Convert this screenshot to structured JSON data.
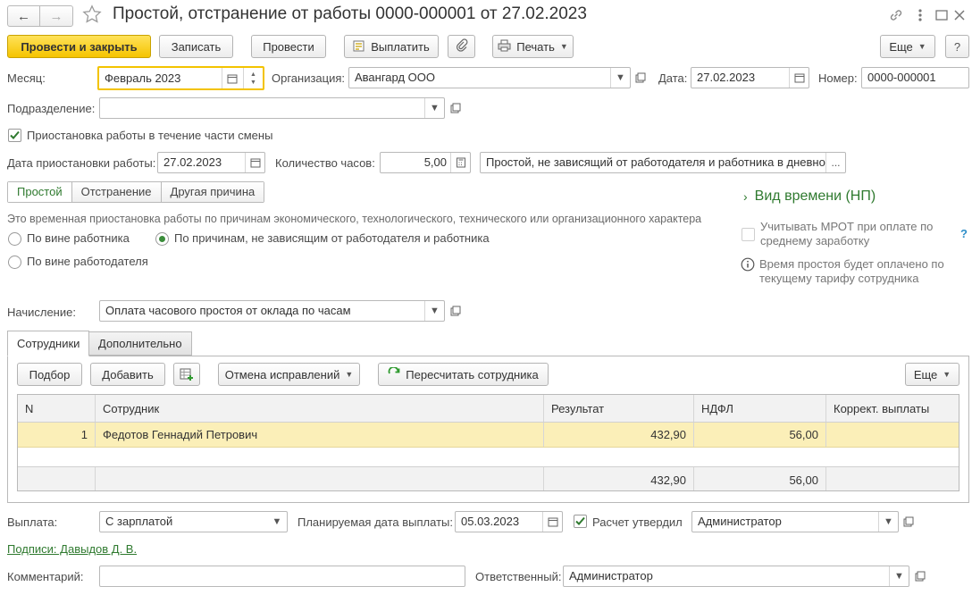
{
  "window": {
    "title": "Простой, отстранение от работы 0000-000001 от 27.02.2023",
    "nav_back": "←",
    "nav_forward": "→"
  },
  "toolbar": {
    "post_close": "Провести и закрыть",
    "save": "Записать",
    "post": "Провести",
    "pay": "Выплатить",
    "print": "Печать",
    "more": "Еще"
  },
  "header": {
    "month_label": "Месяц:",
    "month_value": "Февраль 2023",
    "org_label": "Организация:",
    "org_value": "Авангард ООО",
    "date_label": "Дата:",
    "date_value": "27.02.2023",
    "number_label": "Номер:",
    "number_value": "0000-000001",
    "dept_label": "Подразделение:",
    "dept_value": ""
  },
  "partial": {
    "checkbox_label": "Приостановка работы в течение части смены",
    "checked": true,
    "stop_date_label": "Дата приостановки работы:",
    "stop_date_value": "27.02.2023",
    "hours_label": "Количество часов:",
    "hours_value": "5,00",
    "reason_value": "Простой, не зависящий от работодателя и работника в дневное ..."
  },
  "type_tabs": [
    "Простой",
    "Отстранение",
    "Другая причина"
  ],
  "type_active": 0,
  "description": "Это временная приостановка работы по причинам экономического, технологического, технического или организационного характера",
  "radios": {
    "employee_fault": "По вине работника",
    "independent": "По причинам, не зависящим от работодателя и работника",
    "employer_fault": "По вине работодателя",
    "selected": "independent"
  },
  "right_panel": {
    "time_kind": "Вид времени (НП)",
    "mrot_label": "Учитывать МРОТ при оплате по среднему заработку",
    "help": "?",
    "info_text": "Время простоя будет оплачено по текущему тарифу сотрудника"
  },
  "accrual": {
    "label": "Начисление:",
    "value": "Оплата часового простоя от оклада по часам"
  },
  "tabs": {
    "employees": "Сотрудники",
    "additional": "Дополнительно"
  },
  "grid_toolbar": {
    "pick": "Подбор",
    "add": "Добавить",
    "cancel_corrections": "Отмена исправлений",
    "recalc": "Пересчитать сотрудника",
    "more": "Еще"
  },
  "grid": {
    "columns": [
      "N",
      "Сотрудник",
      "Результат",
      "НДФЛ",
      "Коррект. выплаты"
    ],
    "rows": [
      {
        "n": "1",
        "employee": "Федотов Геннадий Петрович",
        "result": "432,90",
        "ndfl": "56,00",
        "correction": ""
      }
    ],
    "totals": {
      "result": "432,90",
      "ndfl": "56,00"
    }
  },
  "payment": {
    "label": "Выплата:",
    "value": "С зарплатой",
    "planned_label": "Планируемая дата выплаты:",
    "planned_value": "05.03.2023",
    "approved_label": "Расчет утвердил",
    "approved_checked": true,
    "approved_value": "Администратор"
  },
  "signatures_link": "Подписи: Давыдов Д. В.",
  "comment": {
    "label": "Комментарий:",
    "value": ""
  },
  "responsible": {
    "label": "Ответственный:",
    "value": "Администратор"
  },
  "colors": {
    "accent_green": "#2f7a2f",
    "primary_button": "#f5c400",
    "selected_row": "#fbefb8"
  }
}
